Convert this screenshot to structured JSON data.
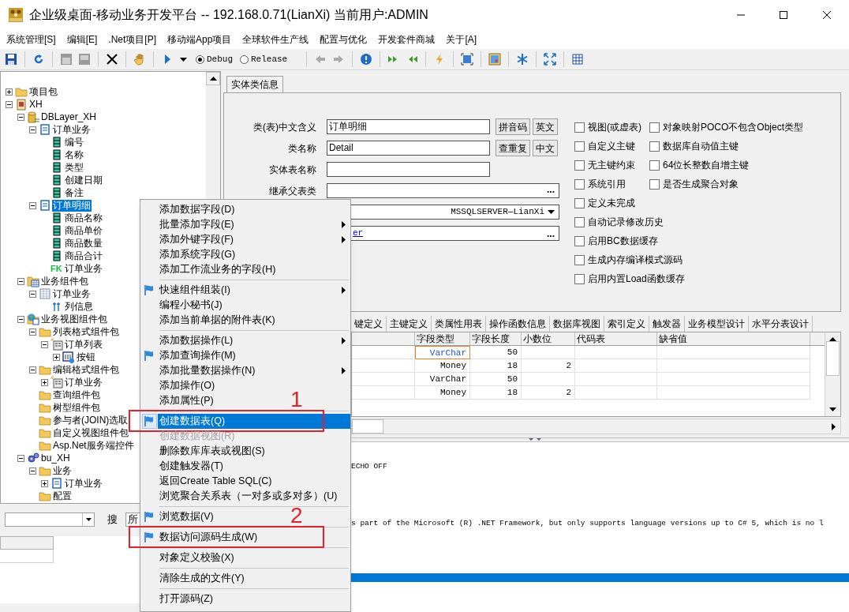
{
  "window": {
    "title": "企业级桌面-移动业务开发平台 -- 192.168.0.71(LianXi) 当前用户:ADMIN"
  },
  "menu_bar": [
    "系统管理[S]",
    "编辑[E]",
    ".Net项目[P]",
    "移动端App项目",
    "全球软件生产线",
    "配置与优化",
    "开发套件商城",
    "关于[A]"
  ],
  "build_modes": [
    {
      "label": "Debug",
      "selected": true
    },
    {
      "label": "Release",
      "selected": false
    }
  ],
  "tree": [
    {
      "label": "项目包",
      "kind": "folder",
      "expanded": false,
      "selected": false
    },
    {
      "label": "XH",
      "kind": "project",
      "expanded": true,
      "selected": false,
      "children": [
        {
          "label": "DBLayer_XH",
          "kind": "database",
          "expanded": true,
          "selected": false,
          "children": [
            {
              "label": "订单业务",
              "kind": "table",
              "expanded": true,
              "selected": false,
              "children": [
                {
                  "label": "编号",
                  "kind": "field",
                  "selected": false
                },
                {
                  "label": "名称",
                  "kind": "field",
                  "selected": false
                },
                {
                  "label": "类型",
                  "kind": "field",
                  "selected": false
                },
                {
                  "label": "创建日期",
                  "kind": "field",
                  "selected": false
                },
                {
                  "label": "备注",
                  "kind": "field",
                  "selected": false
                }
              ]
            },
            {
              "label": "订单明细",
              "kind": "table",
              "expanded": true,
              "selected": true,
              "children": [
                {
                  "label": "商品名称",
                  "kind": "field",
                  "selected": false
                },
                {
                  "label": "商品单价",
                  "kind": "field",
                  "selected": false
                },
                {
                  "label": "商品数量",
                  "kind": "field",
                  "selected": false
                },
                {
                  "label": "商品合计",
                  "kind": "field",
                  "selected": false
                },
                {
                  "label": "订单业务",
                  "badge": "FK",
                  "selected": false
                }
              ]
            }
          ]
        },
        {
          "label": "业务组件包",
          "kind": "grid-folder",
          "expanded": true,
          "selected": false,
          "children": [
            {
              "label": "订单业务",
              "kind": "grid",
              "expanded": true,
              "selected": false,
              "children": [
                {
                  "label": "列信息",
                  "kind": "columns",
                  "selected": false
                }
              ]
            }
          ]
        },
        {
          "label": "业务视图组件包",
          "kind": "globe-folder",
          "expanded": true,
          "selected": false,
          "children": [
            {
              "label": "列表格式组件包",
              "kind": "folder",
              "expanded": true,
              "selected": false,
              "children": [
                {
                  "label": "订单列表",
                  "kind": "form",
                  "expanded": true,
                  "selected": false,
                  "children": [
                    {
                      "label": "按钮",
                      "kind": "button",
                      "expanded": false,
                      "selected": false
                    }
                  ]
                }
              ]
            },
            {
              "label": "编辑格式组件包",
              "kind": "folder",
              "expanded": true,
              "selected": false,
              "children": [
                {
                  "label": "订单业务",
                  "kind": "form",
                  "expanded": false,
                  "selected": false
                }
              ]
            },
            {
              "label": "查询组件包",
              "kind": "folder",
              "selected": false
            },
            {
              "label": "树型组件包",
              "kind": "folder",
              "selected": false
            },
            {
              "label": "参与者(JOIN)选取",
              "kind": "folder",
              "selected": false
            },
            {
              "label": "自定义视图组件包",
              "kind": "folder",
              "selected": false
            },
            {
              "label": "Asp.Net服务端控件",
              "kind": "folder",
              "selected": false
            }
          ]
        },
        {
          "label": "bu_XH",
          "kind": "gear",
          "expanded": true,
          "selected": false,
          "children": [
            {
              "label": "业务",
              "kind": "folder",
              "expanded": true,
              "selected": false,
              "children": [
                {
                  "label": "订单业务",
                  "kind": "table",
                  "expanded": false,
                  "selected": false
                }
              ]
            },
            {
              "label": "配置",
              "kind": "folder",
              "selected": false
            }
          ]
        }
      ]
    }
  ],
  "search": {
    "label": "搜",
    "scope": "所"
  },
  "entity_tabs": [
    {
      "label": "实体类信息",
      "selected": true
    }
  ],
  "form_rows": [
    {
      "kind": "text",
      "label": "类(表)中文含义",
      "value": "订单明细",
      "buttons": [
        "拼音码",
        "英文"
      ]
    },
    {
      "kind": "text",
      "label": "类名称",
      "value": "Detail",
      "buttons": [
        "查重复",
        "中文"
      ]
    },
    {
      "kind": "text",
      "label": "实体表名称"
    },
    {
      "kind": "browse",
      "label": "继承父表类",
      "button": "..."
    },
    {
      "kind": "dropdown",
      "value": "MSSQLSERVER—LianXi"
    },
    {
      "kind": "link",
      "value": "er",
      "button": "..."
    }
  ],
  "options_left": [
    {
      "label": "视图(或虚表)",
      "checked": false
    },
    {
      "label": "自定义主键",
      "checked": false
    },
    {
      "label": "无主键约束",
      "checked": false
    },
    {
      "label": "系统引用",
      "checked": false
    },
    {
      "label": "定义未完成",
      "checked": false
    },
    {
      "label": "自动记录修改历史",
      "checked": false
    },
    {
      "label": "启用BC数据缓存",
      "checked": false
    },
    {
      "label": "生成内存编译模式源码",
      "checked": false
    },
    {
      "label": "启用内置Load函数缓存",
      "checked": false
    }
  ],
  "options_right": [
    {
      "label": "对象映射POCO不包含Object类型",
      "checked": false
    },
    {
      "label": "数据库自动值主键",
      "checked": false
    },
    {
      "label": "64位长整数自增主键",
      "checked": false
    },
    {
      "label": "是否生成聚合对象",
      "checked": false
    }
  ],
  "detail_tabs": [
    {
      "label": "键定义",
      "selected": false
    },
    {
      "label": "主键定义",
      "selected": false
    },
    {
      "label": "类属性用表",
      "selected": false
    },
    {
      "label": "操作函数信息",
      "selected": false
    },
    {
      "label": "数据库视图",
      "selected": false
    },
    {
      "label": "索引定义",
      "selected": false
    },
    {
      "label": "触发器",
      "selected": false
    },
    {
      "label": "业务模型设计",
      "selected": false
    },
    {
      "label": "水平分表设计",
      "selected": false
    }
  ],
  "table": {
    "columns": [
      "字段类型",
      "字段长度",
      "小数位",
      "代码表",
      "缺省值"
    ],
    "rows": [
      {
        "cells": [
          "VarChar",
          "50",
          "",
          "",
          ""
        ],
        "selected": true
      },
      {
        "cells": [
          "Money",
          "18",
          "2",
          "",
          ""
        ],
        "selected": false
      },
      {
        "cells": [
          "VarChar",
          "50",
          "",
          "",
          ""
        ],
        "selected": false
      },
      {
        "cells": [
          "Money",
          "18",
          "2",
          "",
          ""
        ],
        "selected": false
      }
    ]
  },
  "output": {
    "lines": [
      "ECHO OFF",
      "s part of the Microsoft (R) .NET Framework, but only supports language versions up to C# 5, which is no l"
    ],
    "selection_bar": true
  },
  "context_menu": [
    {
      "kind": "item",
      "label": "添加数据字段(D)",
      "flag": false,
      "submenu": false,
      "disabled": false,
      "selected": false
    },
    {
      "kind": "item",
      "label": "批量添加字段(E)",
      "flag": false,
      "submenu": true,
      "disabled": false,
      "selected": false
    },
    {
      "kind": "item",
      "label": "添加外键字段(F)",
      "flag": false,
      "submenu": true,
      "disabled": false,
      "selected": false
    },
    {
      "kind": "item",
      "label": "添加系统字段(G)",
      "flag": false,
      "submenu": false,
      "disabled": false,
      "selected": false
    },
    {
      "kind": "item",
      "label": "添加工作流业务的字段(H)",
      "flag": false,
      "submenu": false,
      "disabled": false,
      "selected": false
    },
    {
      "kind": "separator"
    },
    {
      "kind": "item",
      "label": "快速组件组装(I)",
      "flag": true,
      "submenu": true,
      "disabled": false,
      "selected": false
    },
    {
      "kind": "item",
      "label": "编程小秘书(J)",
      "flag": false,
      "submenu": false,
      "disabled": false,
      "selected": false
    },
    {
      "kind": "item",
      "label": "添加当前单据的附件表(K)",
      "flag": false,
      "submenu": false,
      "disabled": false,
      "selected": false
    },
    {
      "kind": "separator"
    },
    {
      "kind": "item",
      "label": "添加数据操作(L)",
      "flag": false,
      "submenu": true,
      "disabled": false,
      "selected": false
    },
    {
      "kind": "item",
      "label": "添加查询操作(M)",
      "flag": true,
      "submenu": false,
      "disabled": false,
      "selected": false
    },
    {
      "kind": "item",
      "label": "添加批量数据操作(N)",
      "flag": false,
      "submenu": true,
      "disabled": false,
      "selected": false
    },
    {
      "kind": "item",
      "label": "添加操作(O)",
      "flag": false,
      "submenu": false,
      "disabled": false,
      "selected": false
    },
    {
      "kind": "item",
      "label": "添加属性(P)",
      "flag": false,
      "submenu": false,
      "disabled": false,
      "selected": false
    },
    {
      "kind": "separator"
    },
    {
      "kind": "item",
      "label": "创建数据表(Q)",
      "flag": true,
      "submenu": false,
      "disabled": false,
      "selected": true,
      "annotation": "1"
    },
    {
      "kind": "item",
      "label": "创建数据视图(R)",
      "flag": false,
      "submenu": false,
      "disabled": true,
      "selected": false
    },
    {
      "kind": "item",
      "label": "删除数库库表或视图(S)",
      "flag": false,
      "submenu": false,
      "disabled": false,
      "selected": false
    },
    {
      "kind": "item",
      "label": "创建触发器(T)",
      "flag": false,
      "submenu": false,
      "disabled": false,
      "selected": false
    },
    {
      "kind": "item",
      "label": "返回Create Table SQL(C)",
      "flag": false,
      "submenu": false,
      "disabled": false,
      "selected": false
    },
    {
      "kind": "item",
      "label": "浏览聚合关系表（一对多或多对多）(U)",
      "flag": false,
      "submenu": false,
      "disabled": false,
      "selected": false
    },
    {
      "kind": "separator"
    },
    {
      "kind": "item",
      "label": "浏览数据(V)",
      "flag": true,
      "submenu": false,
      "disabled": false,
      "selected": false
    },
    {
      "kind": "separator"
    },
    {
      "kind": "item",
      "label": "数据访问源码生成(W)",
      "flag": true,
      "submenu": false,
      "disabled": false,
      "selected": false,
      "annotation": "2"
    },
    {
      "kind": "separator"
    },
    {
      "kind": "item",
      "label": "对象定义校验(X)",
      "flag": false,
      "submenu": false,
      "disabled": false,
      "selected": false
    },
    {
      "kind": "separator"
    },
    {
      "kind": "item",
      "label": "清除生成的文件(Y)",
      "flag": false,
      "submenu": false,
      "disabled": false,
      "selected": false
    },
    {
      "kind": "separator"
    },
    {
      "kind": "item",
      "label": "打开源码(Z)",
      "flag": false,
      "submenu": false,
      "disabled": false,
      "selected": false
    }
  ]
}
